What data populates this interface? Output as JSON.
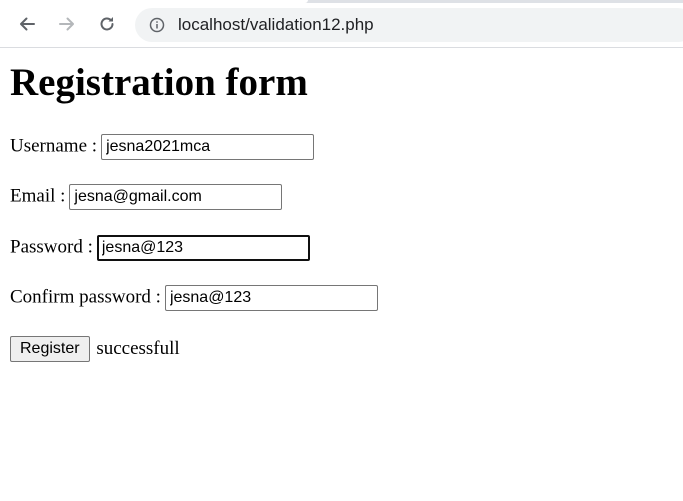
{
  "browser": {
    "url": "localhost/validation12.php",
    "back_icon": "back-arrow-icon",
    "forward_icon": "forward-arrow-icon",
    "reload_icon": "reload-icon",
    "info_icon": "info-icon"
  },
  "page": {
    "title": "Registration form"
  },
  "form": {
    "username": {
      "label": "Username :",
      "value": "jesna2021mca"
    },
    "email": {
      "label": "Email :",
      "value": "jesna@gmail.com"
    },
    "password": {
      "label": "Password :",
      "value": "jesna@123"
    },
    "confirm_password": {
      "label": "Confirm password :",
      "value": "jesna@123"
    },
    "register_label": "Register",
    "status_text": "successfull"
  }
}
